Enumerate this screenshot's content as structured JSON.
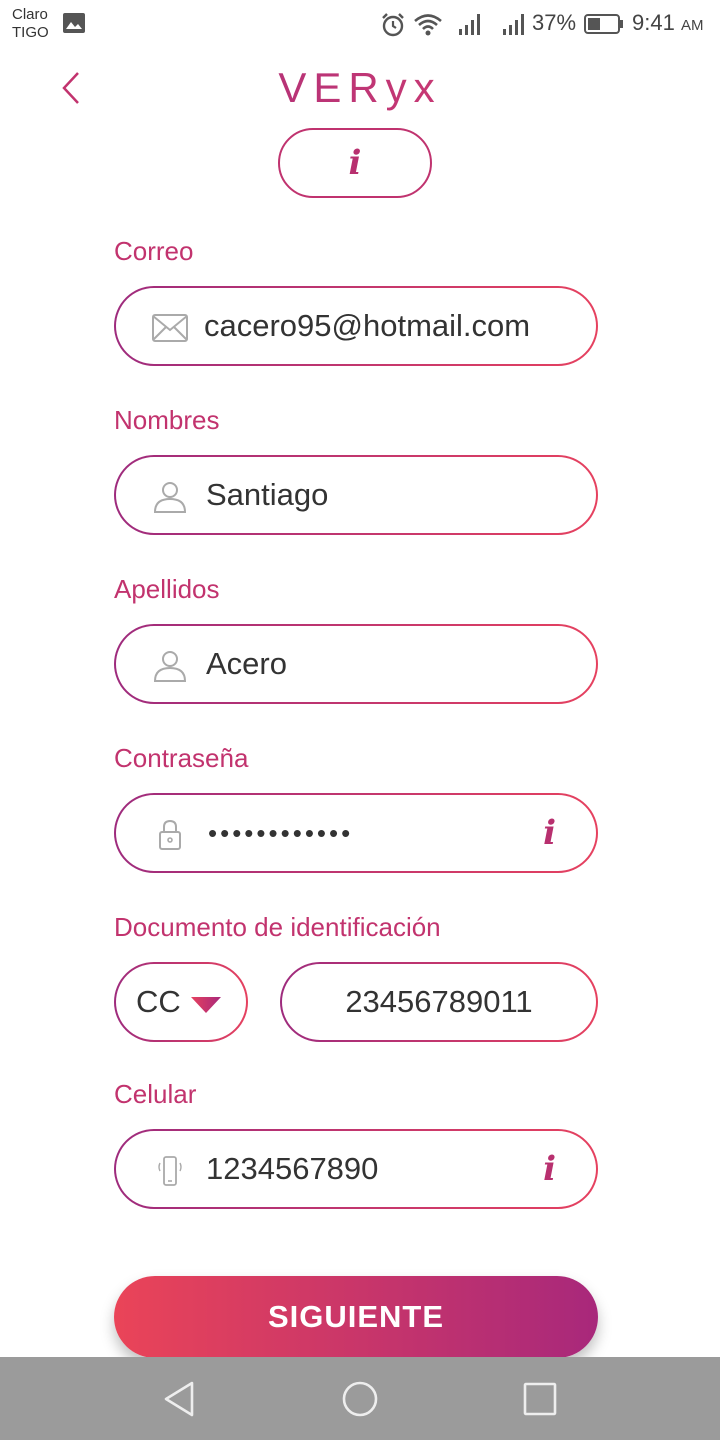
{
  "status_bar": {
    "carrier_line1": "Claro",
    "carrier_line2": "TIGO",
    "battery": "37%",
    "time": "9:41",
    "ampm": "AM"
  },
  "header": {
    "logo": "VERyx",
    "info_glyph": "i"
  },
  "form": {
    "email": {
      "label": "Correo",
      "value": "cacero95@hotmail.com",
      "icon": "envelope-icon"
    },
    "first_name": {
      "label": "Nombres",
      "value": "Santiago",
      "icon": "user-icon"
    },
    "last_name": {
      "label": "Apellidos",
      "value": "Acero",
      "icon": "user-icon"
    },
    "password": {
      "label": "Contraseña",
      "value": "••••••••••••",
      "icon": "lock-icon",
      "tip": "i"
    },
    "document": {
      "label": "Documento de identificación",
      "type": "CC",
      "number": "23456789011"
    },
    "phone": {
      "label": "Celular",
      "value": "1234567890",
      "icon": "phone-icon",
      "tip": "i"
    }
  },
  "actions": {
    "next_label": "SIGUIENTE"
  },
  "colors": {
    "accent_start": "#9e2b7d",
    "accent_end": "#e6415f",
    "label": "#c2336e"
  }
}
